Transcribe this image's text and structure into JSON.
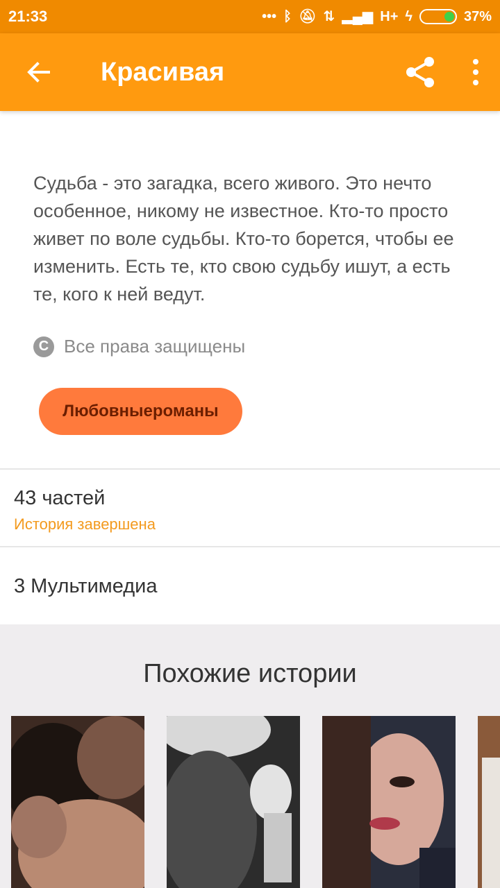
{
  "status_bar": {
    "time": "21:33",
    "network": "H+",
    "battery": "37%",
    "battery_level": 0.37
  },
  "app_bar": {
    "title": "Красивая",
    "back_icon": "arrow-left-icon",
    "share_icon": "share-icon",
    "more_icon": "more-vert-icon",
    "color": "#ff9a0f"
  },
  "story": {
    "description": "Судьба - это загадка, всего живого. Это нечто особенное, никому не известное. Кто-то просто живет по воле судьбы. Кто-то борется, чтобы ее изменить. Есть те, кто свою судьбу ишут, а есть те, кого к ней ведут.",
    "copyright": "Все права защищены",
    "tag": "Любовныероманы",
    "parts": "43 частей",
    "status": "История завершена",
    "multimedia": "3 Мультимедиа"
  },
  "similar": {
    "title": "Похожие истории"
  },
  "colors": {
    "accent": "#ff9a0f",
    "status_bar": "#f08a00",
    "tag": "#ff7a3c",
    "status_text": "#f39a1e"
  }
}
